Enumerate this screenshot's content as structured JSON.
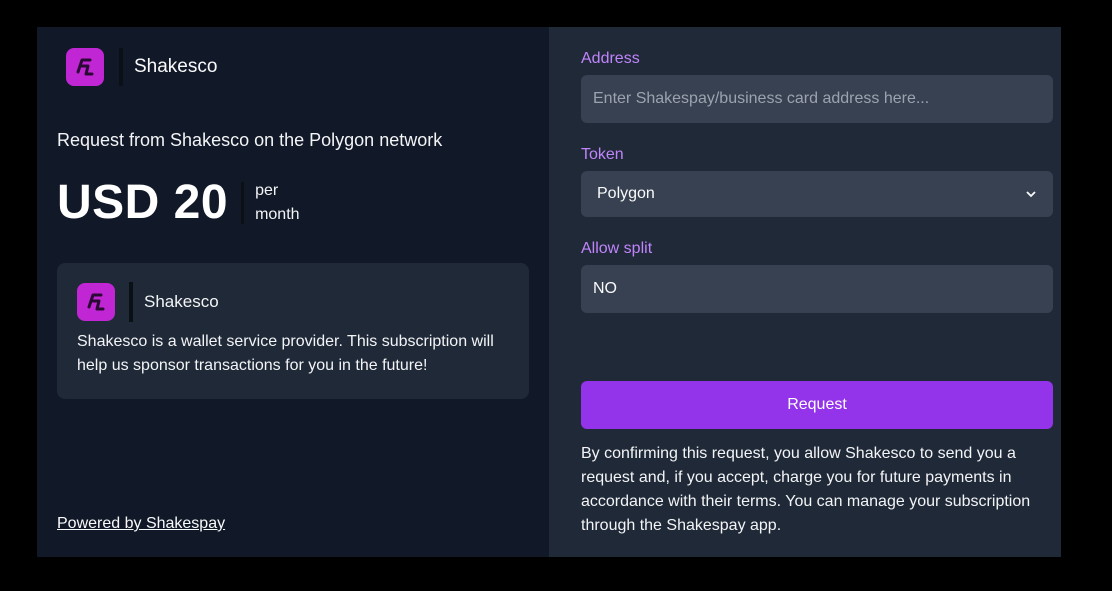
{
  "brand": {
    "name": "Shakesco",
    "logo_color": "#c026d3"
  },
  "request": {
    "title": "Request from Shakesco on the Polygon network",
    "amount": "USD 20",
    "period_line1": "per",
    "period_line2": "month"
  },
  "info": {
    "name": "Shakesco",
    "description": "Shakesco is a wallet service provider. This subscription will help us sponsor transactions for you in the future!"
  },
  "footer": {
    "powered_by": "Powered by Shakespay"
  },
  "form": {
    "address_label": "Address",
    "address_placeholder": "Enter Shakespay/business card address here...",
    "address_value": "",
    "token_label": "Token",
    "token_value": "Polygon",
    "split_label": "Allow split",
    "split_value": "NO",
    "submit_label": "Request",
    "terms": "By confirming this request, you allow Shakesco to send you a request and, if you accept, charge you for future payments in accordance with their terms. You can manage your subscription through the Shakespay app."
  },
  "colors": {
    "accent": "#9333ea",
    "label": "#c084fc",
    "panel_left": "#111827",
    "panel_right": "#1f2937",
    "field_bg": "#374151"
  }
}
